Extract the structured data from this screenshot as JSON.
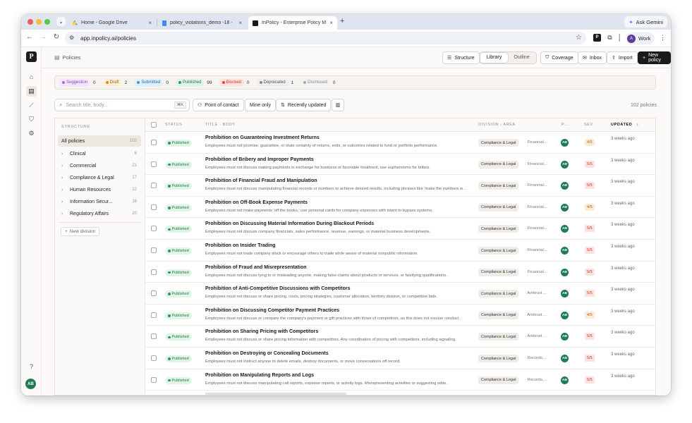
{
  "browser": {
    "tabs": [
      {
        "title": "Home - Google Drive",
        "icon": "google-drive-icon",
        "active": false
      },
      {
        "title": "policy_violations_demo -18 -",
        "icon": "google-docs-icon",
        "active": false
      },
      {
        "title": "InPolicy - Enterprise Policy M",
        "icon": "inpolicy-favicon",
        "active": true
      }
    ],
    "ask_gemini": "Ask Gemini",
    "url": "app.inpolicy.ai/policies",
    "profile": {
      "initial": "A",
      "label": "Work"
    }
  },
  "app": {
    "logo": "P",
    "breadcrumb": "Policies",
    "user_initials": "AB",
    "view_tabs": {
      "structure": "Structure",
      "library": "Library",
      "outline": "Outline"
    },
    "actions": {
      "coverage": "Coverage",
      "inbox": "Inbox",
      "import": "Import",
      "new_policy": "New policy"
    }
  },
  "status_filters": [
    {
      "label": "Suggestion",
      "count": "0",
      "bg": "#f3e8fb",
      "fg": "#8a3fc0",
      "dot": "#b06ae0"
    },
    {
      "label": "Draft",
      "count": "2",
      "bg": "#fcefd9",
      "fg": "#a35f0c",
      "dot": "#d98a22"
    },
    {
      "label": "Submitted",
      "count": "0",
      "bg": "#e1f0fb",
      "fg": "#1f6fa8",
      "dot": "#3b96d8"
    },
    {
      "label": "Published",
      "count": "99",
      "bg": "#e2f4e8",
      "fg": "#1e7a45",
      "dot": "#25a05a"
    },
    {
      "label": "Blocked",
      "count": "0",
      "bg": "#fde2df",
      "fg": "#c63a2c",
      "dot": "#e0483a"
    },
    {
      "label": "Deprecated",
      "count": "1",
      "bg": "#eeeeee",
      "fg": "#555555",
      "dot": "#888888"
    },
    {
      "label": "Dismissed",
      "count": "0",
      "bg": "#f2f2f2",
      "fg": "#888888",
      "dot": "#aaaaaa"
    }
  ],
  "toolbar": {
    "search_placeholder": "Search title, body...",
    "search_shortcut": "⌘K",
    "point_of_contact": "Point of contact",
    "mine_only": "Mine only",
    "sort": "Recently updated",
    "total": "102 policies"
  },
  "structure": {
    "heading": "STRUCTURE",
    "items": [
      {
        "label": "All policies",
        "count": "102"
      },
      {
        "label": "Clinical",
        "count": "6"
      },
      {
        "label": "Commercial",
        "count": "21"
      },
      {
        "label": "Compliance & Legal",
        "count": "17"
      },
      {
        "label": "Human Resources",
        "count": "22"
      },
      {
        "label": "Information Secur...",
        "count": "16"
      },
      {
        "label": "Regulatory Affairs",
        "count": "20"
      }
    ],
    "new_division": "New division"
  },
  "table": {
    "headers": {
      "status": "STATUS",
      "title": "TITLE · BODY",
      "division": "DIVISION › AREA",
      "owner": "P...",
      "sev": "SEV",
      "updated": "UPDATED"
    },
    "rows": [
      {
        "status": "Published",
        "title": "Prohibition on Guaranteeing Investment Returns",
        "body": "Employees must not promise, guarantee, or state certainty of returns, exits, or outcomes related to fund or portfolio performance.",
        "division": "Compliance & Legal",
        "area": "· Financial...",
        "owner": "AB",
        "sev": "4/5",
        "updated": "3 weeks ago"
      },
      {
        "status": "Published",
        "title": "Prohibition of Bribery and Improper Payments",
        "body": "Employees must not discuss making payments in exchange for business or favorable treatment, use euphemisms for bribes.",
        "division": "Compliance & Legal",
        "area": "· Financial...",
        "owner": "AB",
        "sev": "5/5",
        "updated": "3 weeks ago"
      },
      {
        "status": "Published",
        "title": "Prohibition of Financial Fraud and Manipulation",
        "body": "Employees must not discuss manipulating financial records or numbers to achieve desired results, including phrases like 'make the numbers work'.",
        "division": "Compliance & Legal",
        "area": "· Financial...",
        "owner": "AB",
        "sev": "5/5",
        "updated": "3 weeks ago"
      },
      {
        "status": "Published",
        "title": "Prohibition on Off-Book Expense Payments",
        "body": "Employees must not make payments 'off the books,' use personal cards for company expenses with intent to bypass systems.",
        "division": "Compliance & Legal",
        "area": "· Financial...",
        "owner": "AB",
        "sev": "4/5",
        "updated": "3 weeks ago"
      },
      {
        "status": "Published",
        "title": "Prohibition on Discussing Material Information During Blackout Periods",
        "body": "Employees must not discuss company financials, sales performance, revenue, earnings, or material business developments.",
        "division": "Compliance & Legal",
        "area": "· Financial...",
        "owner": "AB",
        "sev": "5/5",
        "updated": "3 weeks ago"
      },
      {
        "status": "Published",
        "title": "Prohibition on Insider Trading",
        "body": "Employees must not trade company stock or encourage others to trade while aware of material nonpublic information.",
        "division": "Compliance & Legal",
        "area": "· Financial...",
        "owner": "AB",
        "sev": "5/5",
        "updated": "3 weeks ago"
      },
      {
        "status": "Published",
        "title": "Prohibition of Fraud and Misrepresentation",
        "body": "Employees must not discuss lying to or misleading anyone, making false claims about products or services, or falsifying qualifications.",
        "division": "Compliance & Legal",
        "area": "· Financial...",
        "owner": "AB",
        "sev": "5/5",
        "updated": "3 weeks ago"
      },
      {
        "status": "Published",
        "title": "Prohibition of Anti-Competitive Discussions with Competitors",
        "body": "Employees must not discuss or share pricing, costs, pricing strategies, customer allocation, territory division, or competitive bids.",
        "division": "Compliance & Legal",
        "area": "· Antitrust ...",
        "owner": "AB",
        "sev": "5/5",
        "updated": "3 weeks ago"
      },
      {
        "status": "Published",
        "title": "Prohibition on Discussing Competitor Payment Practices",
        "body": "Employees must not discuss or compare the company's payment or gift practices with those of competitors, as this does not excuse conduct.",
        "division": "Compliance & Legal",
        "area": "· Antitrust ...",
        "owner": "AB",
        "sev": "4/5",
        "updated": "3 weeks ago"
      },
      {
        "status": "Published",
        "title": "Prohibition on Sharing Pricing with Competitors",
        "body": "Employees must not discuss or share pricing information with competitors. Any coordination of pricing with competitors, including signaling.",
        "division": "Compliance & Legal",
        "area": "· Antitrust ...",
        "owner": "AB",
        "sev": "5/5",
        "updated": "3 weeks ago"
      },
      {
        "status": "Published",
        "title": "Prohibition on Destroying or Concealing Documents",
        "body": "Employees must not instruct anyone to delete emails, destroy documents, or move conversations off record.",
        "division": "Compliance & Legal",
        "area": "· Records,...",
        "owner": "AB",
        "sev": "5/5",
        "updated": "3 weeks ago"
      },
      {
        "status": "Published",
        "title": "Prohibition on Manipulating Reports and Logs",
        "body": "Employees must not discuss manipulating call reports, expense reports, or activity logs. Misrepresenting activities or suggesting edits.",
        "division": "Compliance & Legal",
        "area": "· Records,...",
        "owner": "AB",
        "sev": "5/5",
        "updated": "3 weeks ago"
      }
    ]
  }
}
